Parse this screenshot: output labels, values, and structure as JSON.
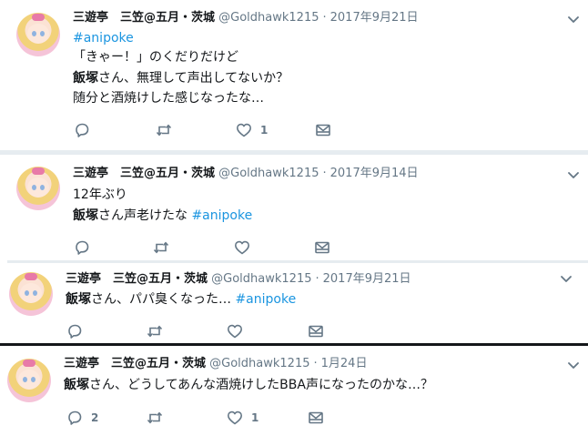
{
  "tweets": [
    {
      "name": "三遊亭　三笠@五月・茨城",
      "handle": "@Goldhawk1215",
      "dot": "·",
      "date": "2017年9月21日",
      "line1_hashtag": "#anipoke",
      "line2": "「きゃー！」のくだりだけど",
      "line3_bold": "飯塚",
      "line3_rest": "さん、無理して声出してないか？",
      "line4": "随分と酒焼けした感じなったな…",
      "reply_count": "",
      "retweet_count": "",
      "like_count": "1"
    },
    {
      "name": "三遊亭　三笠@五月・茨城",
      "handle": "@Goldhawk1215",
      "dot": "·",
      "date": "2017年9月14日",
      "line1": "12年ぶり",
      "line2_bold": "飯塚",
      "line2_rest": "さん声老けたな",
      "line2_hashtag": "#anipoke",
      "reply_count": "",
      "retweet_count": "",
      "like_count": ""
    },
    {
      "name": "三遊亭　三笠@五月・茨城",
      "handle": "@Goldhawk1215",
      "dot": "·",
      "date": "2017年9月21日",
      "line1_bold": "飯塚",
      "line1_rest": "さん、パパ臭くなった…",
      "line1_hashtag": "#anipoke",
      "reply_count": "",
      "retweet_count": "",
      "like_count": ""
    },
    {
      "name": "三遊亭　三笠@五月・茨城",
      "handle": "@Goldhawk1215",
      "dot": "·",
      "date": "1月24日",
      "line1_bold": "飯塚",
      "line1_rest": "さん、どうしてあんな酒焼けしたBBA声になったのかな…？",
      "reply_count": "2",
      "retweet_count": "",
      "like_count": "1"
    }
  ],
  "icons": {
    "reply": "reply-icon",
    "retweet": "retweet-icon",
    "like": "heart-icon",
    "dm": "envelope-icon",
    "menu": "chevron-down-icon"
  },
  "colors": {
    "icon": "#657786",
    "hashtag": "#1b95e0",
    "text": "#14171a",
    "meta": "#657786"
  }
}
